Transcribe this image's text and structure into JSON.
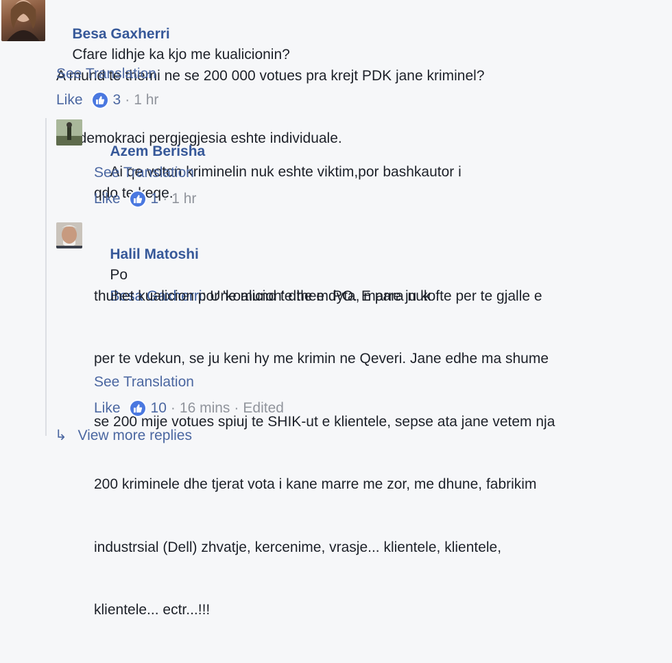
{
  "comments": [
    {
      "author": "Besa Gaxherri",
      "text_first": "Cfare lidhje ka kjo me kualicionin?",
      "lines": [
        "A mund te themi ne se 200 000 votues pra krejt PDK jane kriminel?",
        "Ne demokraci pergjegjesia eshte individuale."
      ],
      "see_translation": "See Translation",
      "like_label": "Like",
      "reaction_icon": "like-icon",
      "reaction_count": "3",
      "time": "1 hr"
    },
    {
      "author": "Azem Berisha",
      "text_first": "Ai qe voton kriminelin nuk eshte viktim,por bashkautor i",
      "lines": [
        "qdo te keqe."
      ],
      "see_translation": "See Translation",
      "like_label": "Like",
      "reaction_icon": "like-icon",
      "reaction_count": "1",
      "time": "1 hr"
    },
    {
      "author": "Halil Matoshi",
      "text_before_mention": "Po",
      "mention": "Besa Gaxherri",
      "text_first": ": Une mund te them PO. E para nuk",
      "lines": [
        "thuhet kualicion por 'koalicion' dhe e dyta, marre ju kofte per te gjalle e",
        "per te vdekun, se ju keni hy me krimin ne Qeveri. Jane edhe ma shume",
        "se 200 mije votues spiuj te SHIK-ut e klientele, sepse ata jane vetem nja",
        "200 kriminele dhe tjerat vota i kane marre me zor, me dhune, fabrikim",
        "industrsial (Dell) zhvatje, kercenime, vrasje... klientele, klientele,",
        "klientele... ectr...!!!"
      ],
      "see_translation": "See Translation",
      "like_label": "Like",
      "reaction_icon": "like-icon",
      "reaction_count": "10",
      "time": "16 mins",
      "edited": "Edited"
    }
  ],
  "more_replies": "View more replies",
  "colors": {
    "link": "#365899",
    "meta": "#90949c",
    "reaction": "#4a78e0",
    "background": "#f6f7f9"
  }
}
